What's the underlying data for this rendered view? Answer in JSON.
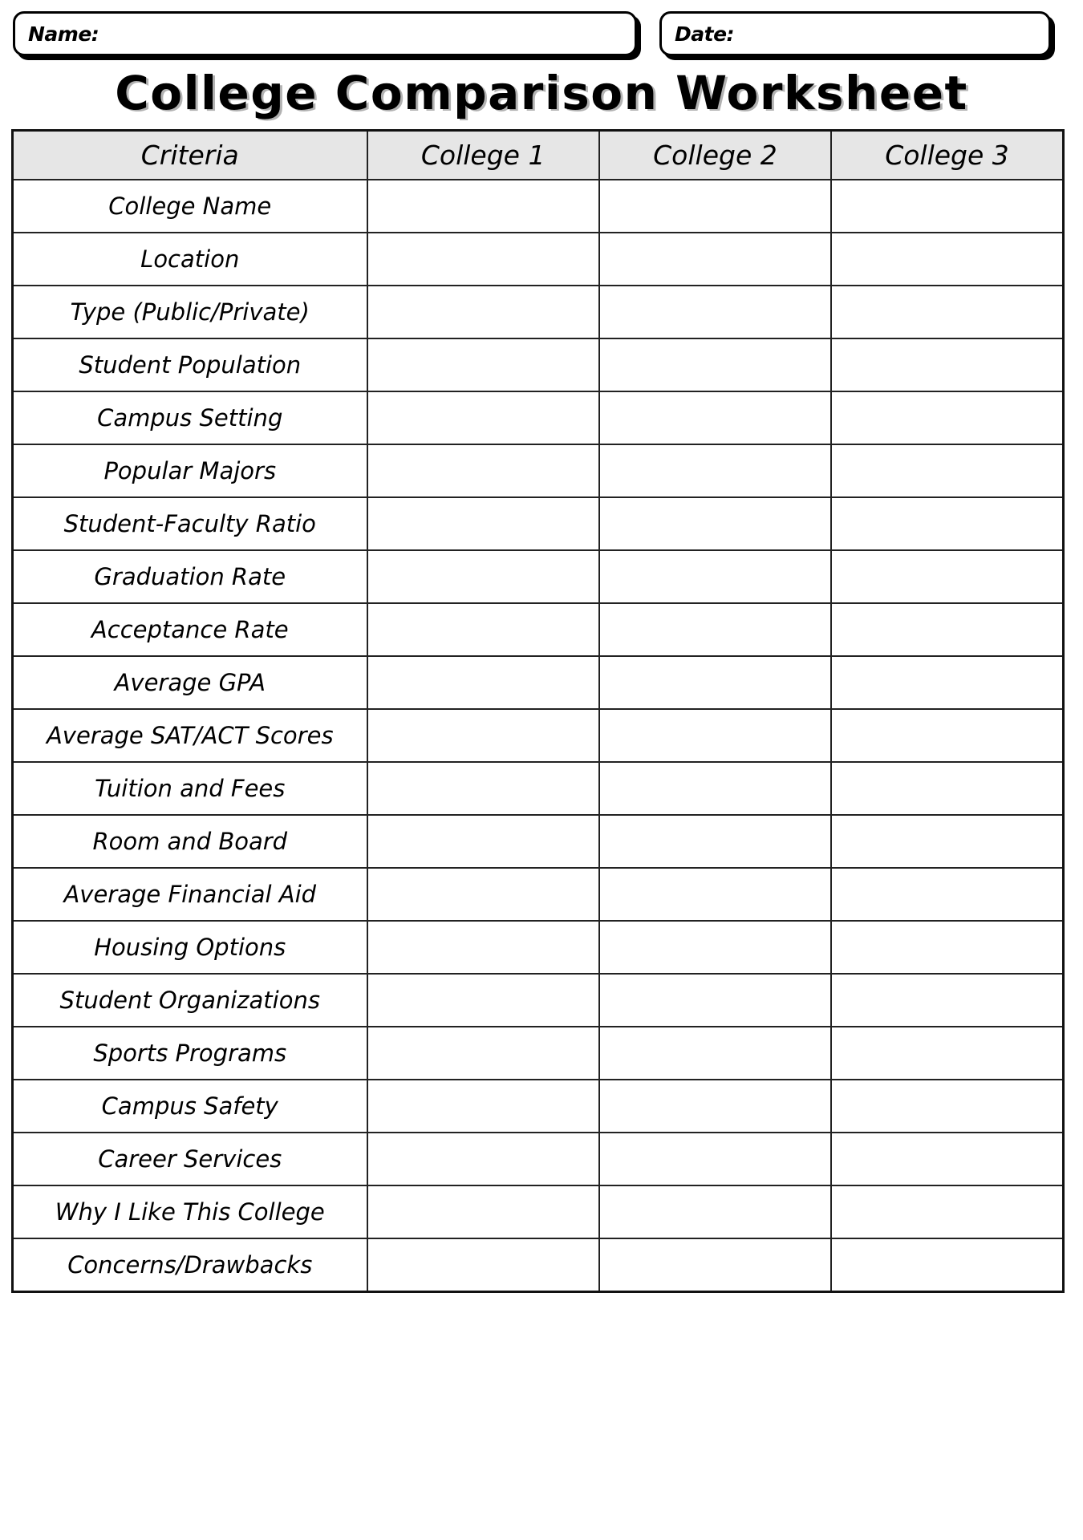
{
  "header": {
    "name_label": "Name:",
    "date_label": "Date:",
    "name_value": "",
    "date_value": ""
  },
  "title": "College Comparison Worksheet",
  "table": {
    "columns": [
      "Criteria",
      "College 1",
      "College 2",
      "College 3"
    ],
    "rows": [
      "College Name",
      "Location",
      "Type (Public/Private)",
      "Student Population",
      "Campus Setting",
      "Popular Majors",
      "Student-Faculty Ratio",
      "Graduation Rate",
      "Acceptance Rate",
      "Average GPA",
      "Average SAT/ACT Scores",
      "Tuition and Fees",
      "Room and Board",
      "Average Financial Aid",
      "Housing Options",
      "Student Organizations",
      "Sports Programs",
      "Campus Safety",
      "Career Services",
      "Why I Like This College",
      "Concerns/Drawbacks"
    ],
    "cell_values": [
      [
        "",
        "",
        ""
      ],
      [
        "",
        "",
        ""
      ],
      [
        "",
        "",
        ""
      ],
      [
        "",
        "",
        ""
      ],
      [
        "",
        "",
        ""
      ],
      [
        "",
        "",
        ""
      ],
      [
        "",
        "",
        ""
      ],
      [
        "",
        "",
        ""
      ],
      [
        "",
        "",
        ""
      ],
      [
        "",
        "",
        ""
      ],
      [
        "",
        "",
        ""
      ],
      [
        "",
        "",
        ""
      ],
      [
        "",
        "",
        ""
      ],
      [
        "",
        "",
        ""
      ],
      [
        "",
        "",
        ""
      ],
      [
        "",
        "",
        ""
      ],
      [
        "",
        "",
        ""
      ],
      [
        "",
        "",
        ""
      ],
      [
        "",
        "",
        ""
      ],
      [
        "",
        "",
        ""
      ],
      [
        "",
        "",
        ""
      ]
    ]
  },
  "colors": {
    "header_fill": "#e6e6e6",
    "border": "#222222",
    "text": "#000000",
    "page_background": "#ffffff"
  }
}
